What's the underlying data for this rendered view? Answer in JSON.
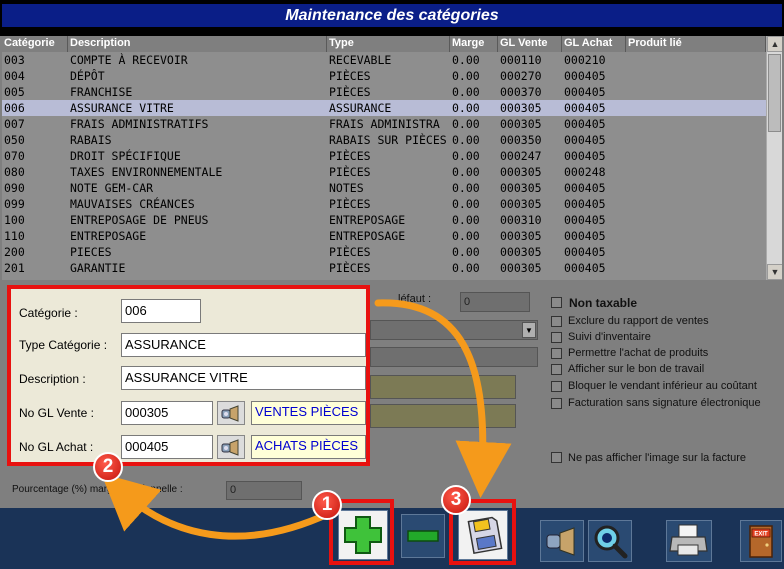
{
  "window": {
    "title": "Maintenance des catégories"
  },
  "grid": {
    "columns": [
      "Catégorie",
      "Description",
      "Type",
      "Marge",
      "GL Vente",
      "GL Achat",
      "Produit lié"
    ],
    "rows": [
      [
        "003",
        "COMPTE À RECEVOIR",
        "RECEVABLE",
        "0.00",
        "000110",
        "000210"
      ],
      [
        "004",
        "DÉPÔT",
        "PIÈCES",
        "0.00",
        "000270",
        "000405"
      ],
      [
        "005",
        "FRANCHISE",
        "PIÈCES",
        "0.00",
        "000370",
        "000405"
      ],
      [
        "006",
        "ASSURANCE VITRE",
        "ASSURANCE",
        "0.00",
        "000305",
        "000405"
      ],
      [
        "007",
        "FRAIS ADMINISTRATIFS",
        "FRAIS ADMINISTRA",
        "0.00",
        "000305",
        "000405"
      ],
      [
        "050",
        "RABAIS",
        "RABAIS SUR PIÈCES",
        "0.00",
        "000350",
        "000405"
      ],
      [
        "070",
        "DROIT SPÉCIFIQUE",
        "PIÈCES",
        "0.00",
        "000247",
        "000405"
      ],
      [
        "080",
        "TAXES ENVIRONNEMENTALE",
        "PIÈCES",
        "0.00",
        "000305",
        "000248"
      ],
      [
        "090",
        "NOTE GEM-CAR",
        "NOTES",
        "0.00",
        "000305",
        "000405"
      ],
      [
        "099",
        "MAUVAISES CRÉANCES",
        "PIÈCES",
        "0.00",
        "000305",
        "000405"
      ],
      [
        "100",
        "ENTREPOSAGE DE PNEUS",
        "ENTREPOSAGE",
        "0.00",
        "000310",
        "000405"
      ],
      [
        "110",
        "ENTREPOSAGE",
        "ENTREPOSAGE",
        "0.00",
        "000305",
        "000405"
      ],
      [
        "200",
        "PIECES",
        "PIÈCES",
        "0.00",
        "000305",
        "000405"
      ],
      [
        "201",
        "GARANTIE",
        "PIÈCES",
        "0.00",
        "000305",
        "000405"
      ]
    ]
  },
  "form": {
    "categorie_label": "Catégorie :",
    "categorie_value": "006",
    "type_label": "Type Catégorie :",
    "type_value": "ASSURANCE",
    "description_label": "Description :",
    "description_value": "ASSURANCE VITRE",
    "gl_vente_label": "No GL Vente :",
    "gl_vente_value": "000305",
    "gl_vente_desc": "VENTES PIÈCES",
    "gl_achat_label": "No GL Achat :",
    "gl_achat_value": "000405",
    "gl_achat_desc": "ACHATS PIÈCES"
  },
  "background": {
    "defaut_label": "léfaut :",
    "defaut_value": "0",
    "pourcentage_label": "Pourcentage (%) marge additionnelle :",
    "pourcentage_value": "0",
    "options": [
      "Non taxable",
      "Exclure du rapport de ventes",
      "Suivi d'inventaire",
      "Permettre l'achat de produits",
      "Afficher sur le bon de travail",
      "Bloquer le vendant inférieur au coûtant",
      "Facturation sans signature électronique"
    ],
    "image_option": "Ne pas afficher l'image sur la facture"
  },
  "toolbar": {
    "buttons": [
      "add",
      "remove",
      "save",
      "lookup",
      "search",
      "print",
      "exit"
    ],
    "exit_label": "EXIT"
  },
  "annotations": [
    "1",
    "2",
    "3"
  ],
  "colors": {
    "title_bg": "#0a1e87",
    "highlight_red": "#e8110f",
    "arrow_orange": "#f59a1b",
    "selection": "#b8bcd6"
  }
}
